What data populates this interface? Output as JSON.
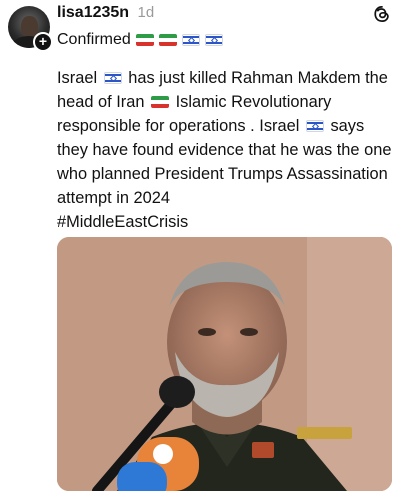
{
  "post": {
    "username": "lisa1235n",
    "timestamp": "1d",
    "status_line": "Confirmed",
    "text_parts": [
      "Israel",
      "has just killed Rahman Makdem the head of Iran",
      "Islamic Revolutionary responsible for operations . Israel",
      "says they have found evidence that he was the one who planned President Trumps Assassination attempt in 2024"
    ],
    "hashtag": "#MiddleEastCrisis"
  },
  "icons": {
    "threads": "threads-logo-icon",
    "follow": "plus-icon",
    "flags": [
      "iran-flag-icon",
      "israel-flag-icon"
    ]
  },
  "colors": {
    "iran_green": "#2e9b47",
    "iran_red": "#d8322c",
    "israel_blue": "#2c56c7",
    "timestamp_gray": "#9a9a9a"
  }
}
